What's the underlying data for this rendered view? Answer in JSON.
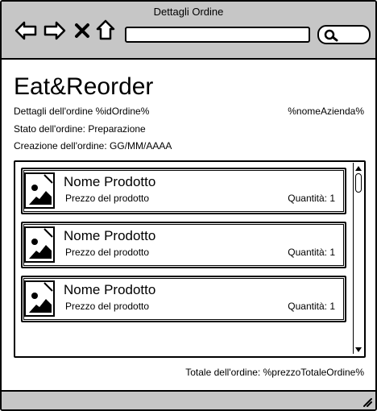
{
  "window": {
    "title": "Dettagli Ordine",
    "nav_icons": [
      "back-arrow-icon",
      "forward-arrow-icon",
      "close-x-icon",
      "home-icon"
    ],
    "url_value": "",
    "search_value": ""
  },
  "app": {
    "name": "Eat&Reorder",
    "order_details": "Dettagli dell'ordine %idOrdine%",
    "company": "%nomeAzienda%",
    "status": "Stato dell'ordine: Preparazione",
    "created": "Creazione dell'ordine: GG/MM/AAAA",
    "total": "Totale dell'ordine: %prezzoTotaleOrdine%"
  },
  "products": [
    {
      "name": "Nome Prodotto",
      "price": "Prezzo del prodotto",
      "qty": "Quantità: 1",
      "icon": "image-icon"
    },
    {
      "name": "Nome Prodotto",
      "price": "Prezzo del prodotto",
      "qty": "Quantità: 1",
      "icon": "image-icon"
    },
    {
      "name": "Nome Prodotto",
      "price": "Prezzo del prodotto",
      "qty": "Quantità: 1",
      "icon": "image-icon"
    }
  ],
  "colors": {
    "chrome": "#c6c6c6",
    "ink": "#000000",
    "background": "#ffffff"
  }
}
